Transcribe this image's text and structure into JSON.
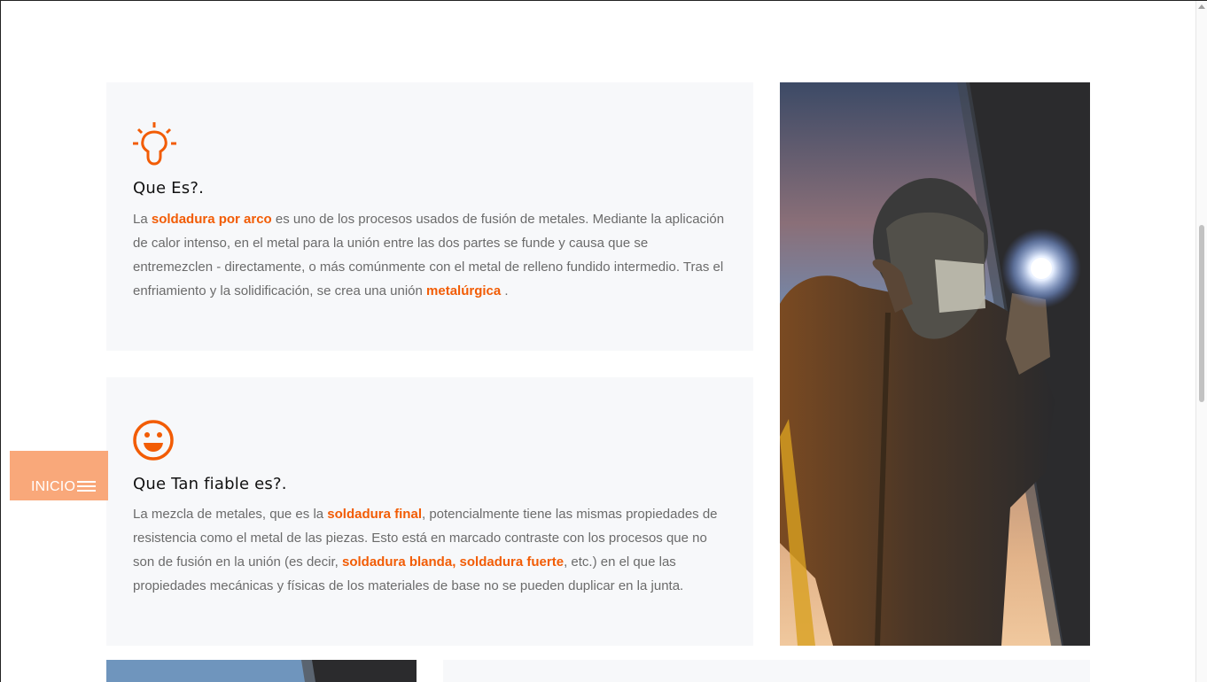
{
  "section_1": {
    "title": "Que Es?.",
    "text_1": "La ",
    "link_1": "soldadura por arco",
    "text_2": " es uno de los procesos usados de fusión de metales. Mediante la aplicación de calor intenso, en el metal para la unión entre las dos partes se funde y causa que se entremezclen - directamente, o más comúnmente con el metal de relleno fundido intermedio. Tras el enfriamiento y la solidificación, se crea una unión ",
    "link_2": "metalúrgica",
    "text_3": " .",
    "icon": "lightbulb-icon"
  },
  "section_2": {
    "title": "Que Tan fiable es?.",
    "text_1": "La mezcla de metales, que es la ",
    "link_1": "soldadura final",
    "text_2": ", potencialmente tiene las mismas propiedades de resistencia como el metal de las piezas. Esto está en marcado contraste con los procesos que no son de fusión en la unión (es decir, ",
    "link_2": "soldadura blanda, soldadura fuerte",
    "text_3": ", etc.) en el que las propiedades mecánicas y físicas de los materiales de base no se pueden duplicar en la junta.",
    "icon": "smiley-icon"
  },
  "inicio_button": {
    "label": "INICIO",
    "icon": "hamburger-menu-icon"
  },
  "colors": {
    "accent": "#f25c05",
    "card_bg": "#f7f8fa",
    "inicio_bg": "#f9a87a",
    "body_text": "#6b6b6b"
  },
  "images": {
    "welder_photo": "welder-photo",
    "bottom_photo": "bottom-photo"
  }
}
